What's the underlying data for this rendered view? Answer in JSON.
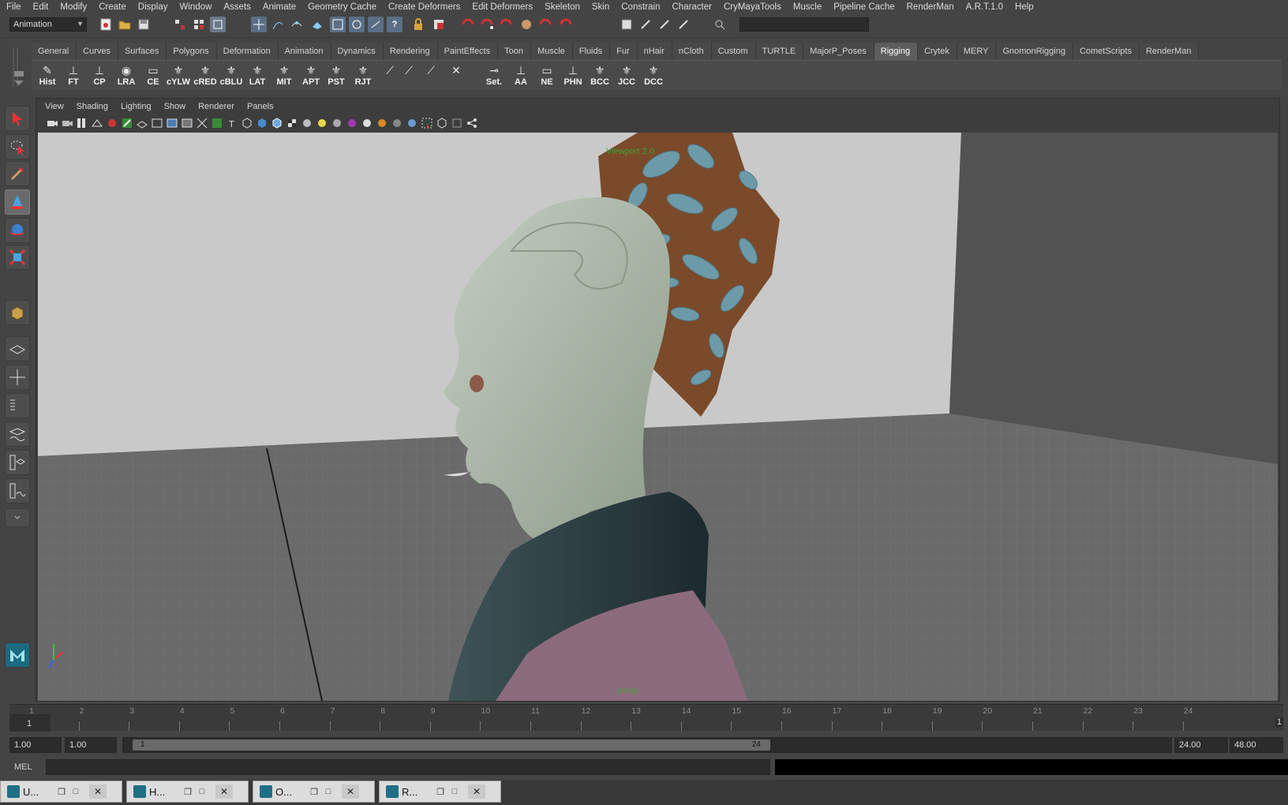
{
  "menubar": {
    "items": [
      "File",
      "Edit",
      "Modify",
      "Create",
      "Display",
      "Window",
      "Assets",
      "Animate",
      "Geometry Cache",
      "Create Deformers",
      "Edit Deformers",
      "Skeleton",
      "Skin",
      "Constrain",
      "Character",
      "CryMayaTools",
      "Muscle",
      "Pipeline Cache",
      "RenderMan",
      "A.R.T.1.0",
      "Help"
    ]
  },
  "statusline": {
    "mode": "Animation",
    "search_value": ""
  },
  "shelf": {
    "tabs": [
      "General",
      "Curves",
      "Surfaces",
      "Polygons",
      "Deformation",
      "Animation",
      "Dynamics",
      "Rendering",
      "PaintEffects",
      "Toon",
      "Muscle",
      "Fluids",
      "Fur",
      "nHair",
      "nCloth",
      "Custom",
      "TURTLE",
      "MajorP_Poses",
      "Rigging",
      "Crytek",
      "MERY",
      "GnomonRigging",
      "CometScripts",
      "RenderMan"
    ],
    "active_tab": "Rigging",
    "buttons": [
      "Hist",
      "FT",
      "CP",
      "LRA",
      "CE",
      "cYLW",
      "cRED",
      "cBLU",
      "LAT",
      "MIT",
      "APT",
      "PST",
      "RJT",
      "",
      "",
      "",
      "",
      "Set.",
      "AA",
      "NE",
      "PHN",
      "BCC",
      "JCC",
      "DCC"
    ]
  },
  "viewport": {
    "panel_menu": [
      "View",
      "Shading",
      "Lighting",
      "Show",
      "Renderer",
      "Panels"
    ],
    "camera_label": "Viewport 2.0",
    "view_label": "persp",
    "colors": {
      "wall": "#c9c9c9",
      "floor": "#6a6a6a",
      "background": "#595959",
      "skin": "#a9b6a6",
      "crest_blue": "#6d9aa9",
      "crest_brown": "#7a4a2a",
      "collar": "#2d3e42",
      "shirt": "#8c6b7c"
    }
  },
  "timeslider": {
    "ticks": [
      "1",
      "2",
      "3",
      "4",
      "5",
      "6",
      "7",
      "8",
      "9",
      "10",
      "11",
      "12",
      "13",
      "14",
      "15",
      "16",
      "17",
      "18",
      "19",
      "20",
      "21",
      "22",
      "23",
      "24"
    ],
    "current_frame": "1",
    "end_marker": "1"
  },
  "rangeslider": {
    "start_time": "1.00",
    "playback_start": "1.00",
    "range_start_label": "1",
    "range_end_label": "24",
    "playback_end": "24.00",
    "end_time": "48.00"
  },
  "cmdline": {
    "label": "MEL",
    "value": ""
  },
  "taskbar": {
    "windows": [
      {
        "name": "U..."
      },
      {
        "name": "H..."
      },
      {
        "name": "O..."
      },
      {
        "name": "R..."
      }
    ]
  }
}
